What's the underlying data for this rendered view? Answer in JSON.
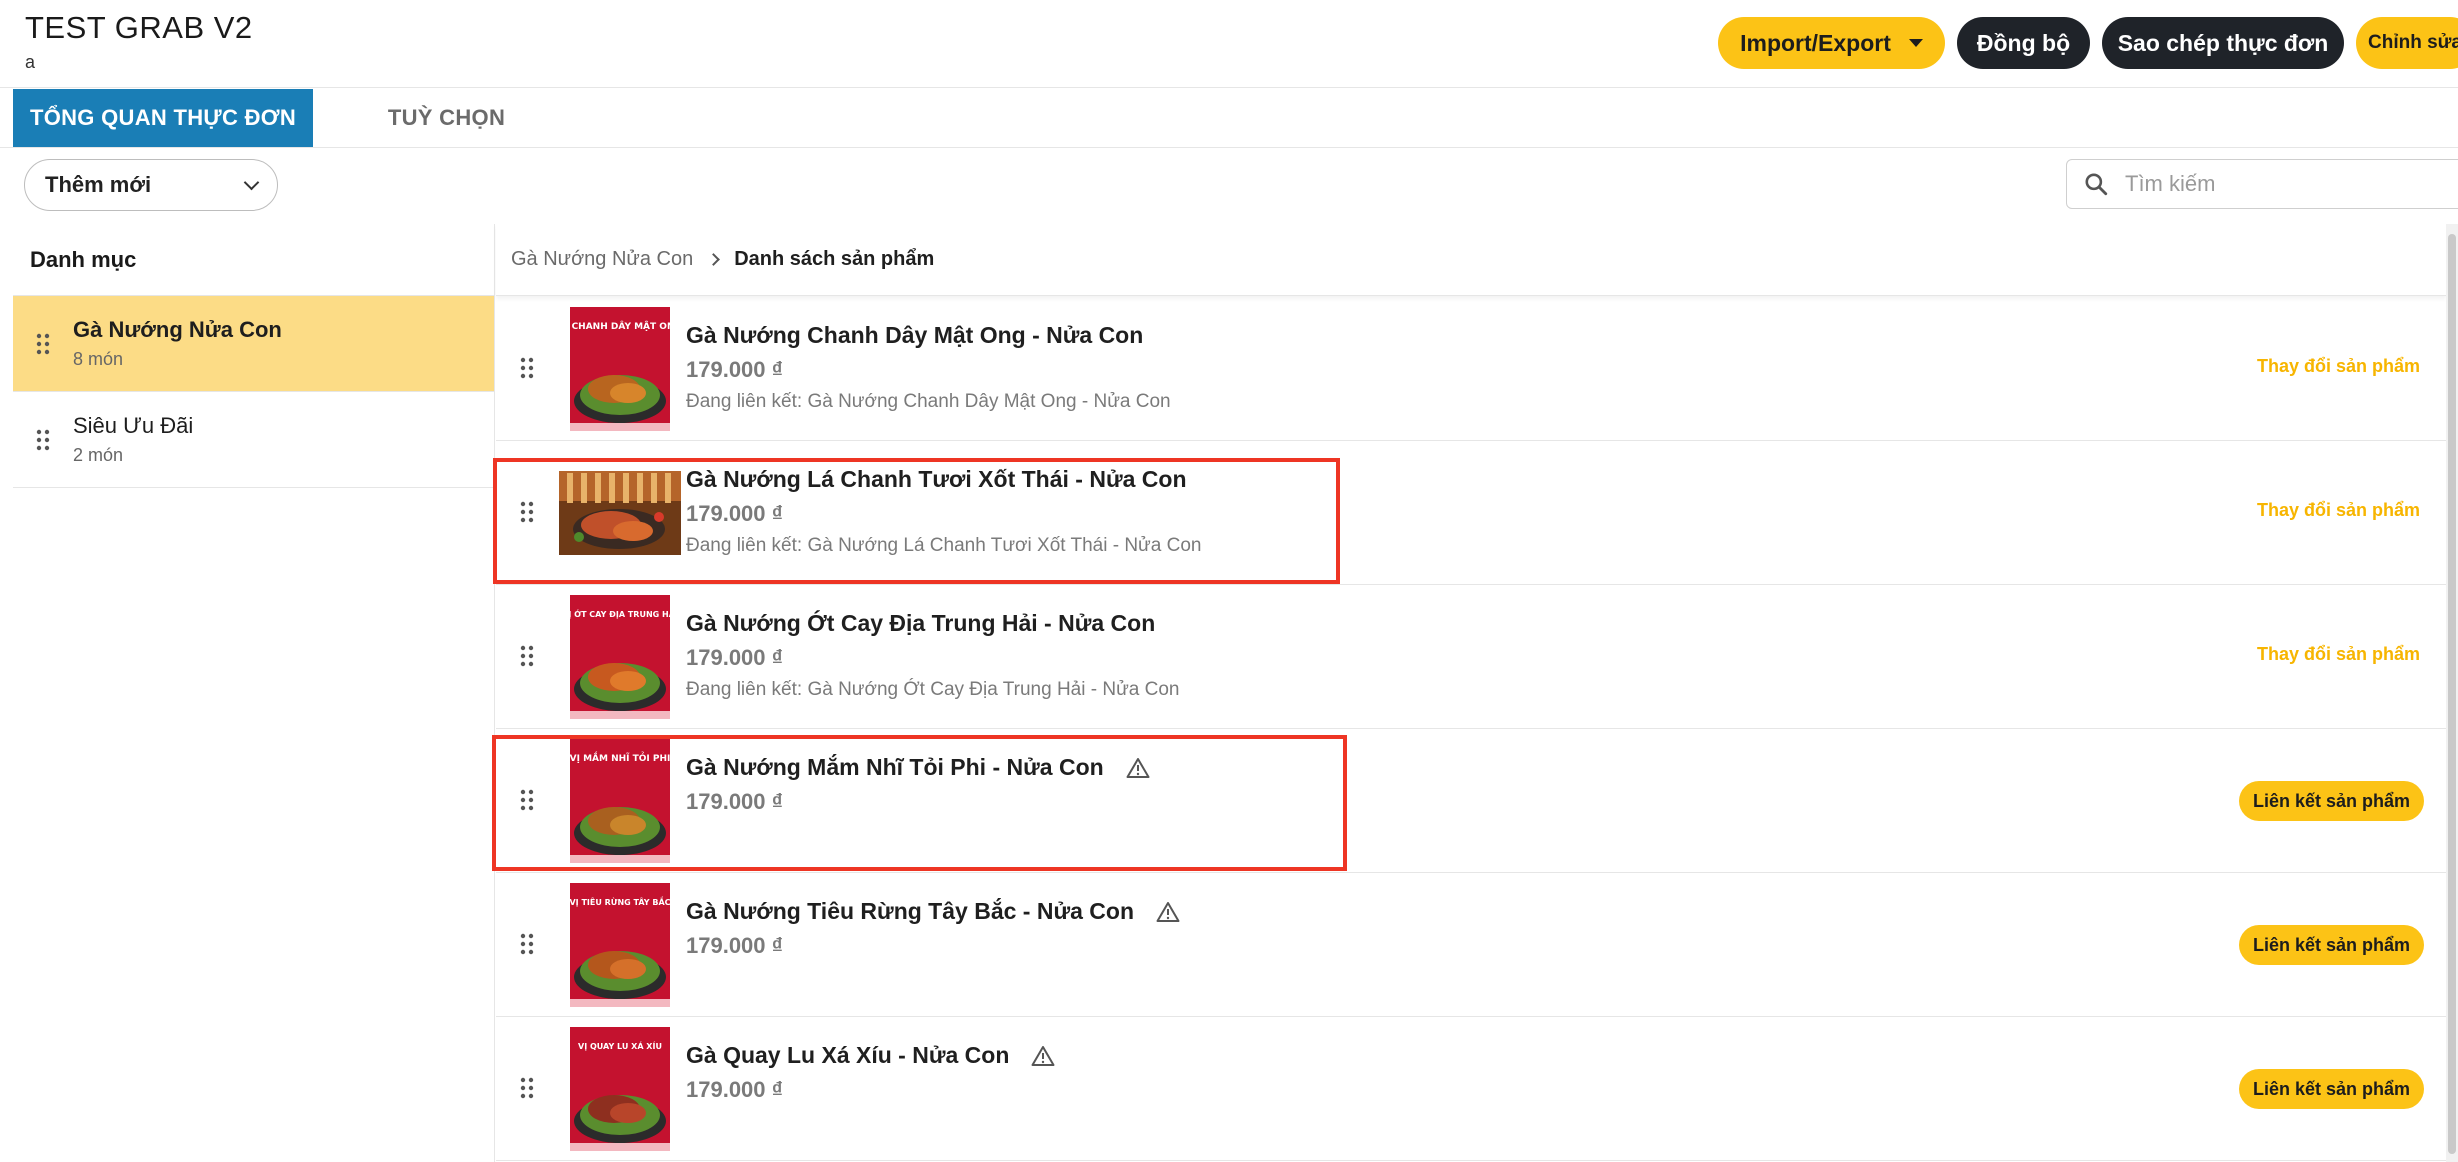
{
  "app": {
    "title": "TEST GRAB V2",
    "subtitle": "a"
  },
  "header": {
    "import_export": "Import/Export",
    "sync": "Đồng bộ",
    "copy_menu": "Sao chép thực đơn",
    "edit": "Chỉnh sửa"
  },
  "tabs": [
    {
      "label": "TỔNG QUAN THỰC ĐƠN",
      "active": true
    },
    {
      "label": "TUỲ CHỌN",
      "active": false
    }
  ],
  "toolbar": {
    "add_new": "Thêm mới",
    "search_placeholder": "Tìm kiếm"
  },
  "sidebar": {
    "header": "Danh mục",
    "categories": [
      {
        "name": "Gà Nướng Nửa Con",
        "count": "8 món",
        "active": true
      },
      {
        "name": "Siêu Ưu Đãi",
        "count": "2 món",
        "active": false
      }
    ]
  },
  "breadcrumb": {
    "parent": "Gà Nướng Nửa Con",
    "current": "Danh sách sản phẩm"
  },
  "products": [
    {
      "name": "Gà Nướng Chanh Dây Mật Ong - Nửa Con",
      "price": "179.000 ₫",
      "linked": "Đang liên kết: Gà Nướng Chanh Dây Mật Ong - Nửa Con",
      "action": "Thay đổi sản phẩm",
      "image_caption": "VỊ CHANH DÂY MẬT ONG"
    },
    {
      "name": "Gà Nướng Lá Chanh Tươi Xốt Thái - Nửa Con",
      "price": "179.000 ₫",
      "linked": "Đang liên kết: Gà Nướng Lá Chanh Tươi Xốt Thái - Nửa Con",
      "action": "Thay đổi sản phẩm",
      "image_caption": ""
    },
    {
      "name": "Gà Nướng Ớt Cay Địa Trung Hải - Nửa Con",
      "price": "179.000 ₫",
      "linked": "Đang liên kết: Gà Nướng Ớt Cay Địa Trung Hải - Nửa Con",
      "action": "Thay đổi sản phẩm",
      "image_caption": "VỊ ỚT CAY ĐỊA TRUNG HẢI"
    },
    {
      "name": "Gà Nướng Mắm Nhĩ Tỏi Phi - Nửa Con",
      "price": "179.000 ₫",
      "linked": "",
      "action": "Liên kết sản phẩm",
      "image_caption": "VỊ MẮM NHĨ TỎI PHI"
    },
    {
      "name": "Gà Nướng Tiêu Rừng Tây Bắc - Nửa Con",
      "price": "179.000 ₫",
      "linked": "",
      "action": "Liên kết sản phẩm",
      "image_caption": "VỊ TIÊU RỪNG TÂY BẮC"
    },
    {
      "name": "Gà Quay Lu Xá Xíu - Nửa Con",
      "price": "179.000 ₫",
      "linked": "",
      "action": "Liên kết sản phẩm",
      "image_caption": "VỊ QUAY LU XÁ XÍU"
    }
  ],
  "colors": {
    "accent_blue": "#1a7eb6",
    "brand_yellow": "#fcc316",
    "active_category": "#fcdc86",
    "highlight_red": "#ee3524"
  }
}
